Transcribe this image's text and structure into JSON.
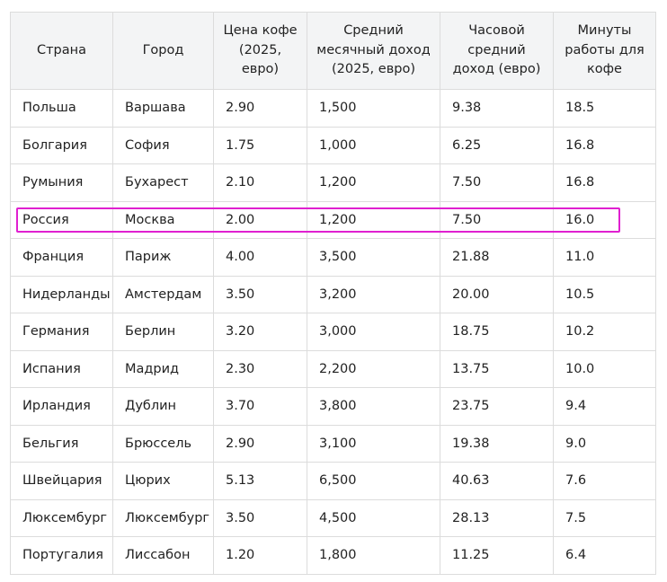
{
  "highlight_color": "#e020d0",
  "chart_data": {
    "type": "table",
    "columns": [
      "Страна",
      "Город",
      "Цена кофе (2025, евро)",
      "Средний месячный доход (2025, евро)",
      "Часовой средний доход (евро)",
      "Минуты работы для кофе"
    ],
    "rows": [
      [
        "Польша",
        "Варшава",
        "2.90",
        "1,500",
        "9.38",
        "18.5"
      ],
      [
        "Болгария",
        "София",
        "1.75",
        "1,000",
        "6.25",
        "16.8"
      ],
      [
        "Румыния",
        "Бухарест",
        "2.10",
        "1,200",
        "7.50",
        "16.8"
      ],
      [
        "Россия",
        "Москва",
        "2.00",
        "1,200",
        "7.50",
        "16.0"
      ],
      [
        "Франция",
        "Париж",
        "4.00",
        "3,500",
        "21.88",
        "11.0"
      ],
      [
        "Нидерланды",
        "Амстердам",
        "3.50",
        "3,200",
        "20.00",
        "10.5"
      ],
      [
        "Германия",
        "Берлин",
        "3.20",
        "3,000",
        "18.75",
        "10.2"
      ],
      [
        "Испания",
        "Мадрид",
        "2.30",
        "2,200",
        "13.75",
        "10.0"
      ],
      [
        "Ирландия",
        "Дублин",
        "3.70",
        "3,800",
        "23.75",
        "9.4"
      ],
      [
        "Бельгия",
        "Брюссель",
        "2.90",
        "3,100",
        "19.38",
        "9.0"
      ],
      [
        "Швейцария",
        "Цюрих",
        "5.13",
        "6,500",
        "40.63",
        "7.6"
      ],
      [
        "Люксембург",
        "Люксембург",
        "3.50",
        "4,500",
        "28.13",
        "7.5"
      ],
      [
        "Португалия",
        "Лиссабон",
        "1.20",
        "1,800",
        "11.25",
        "6.4"
      ]
    ],
    "highlighted_row": "Россия"
  }
}
